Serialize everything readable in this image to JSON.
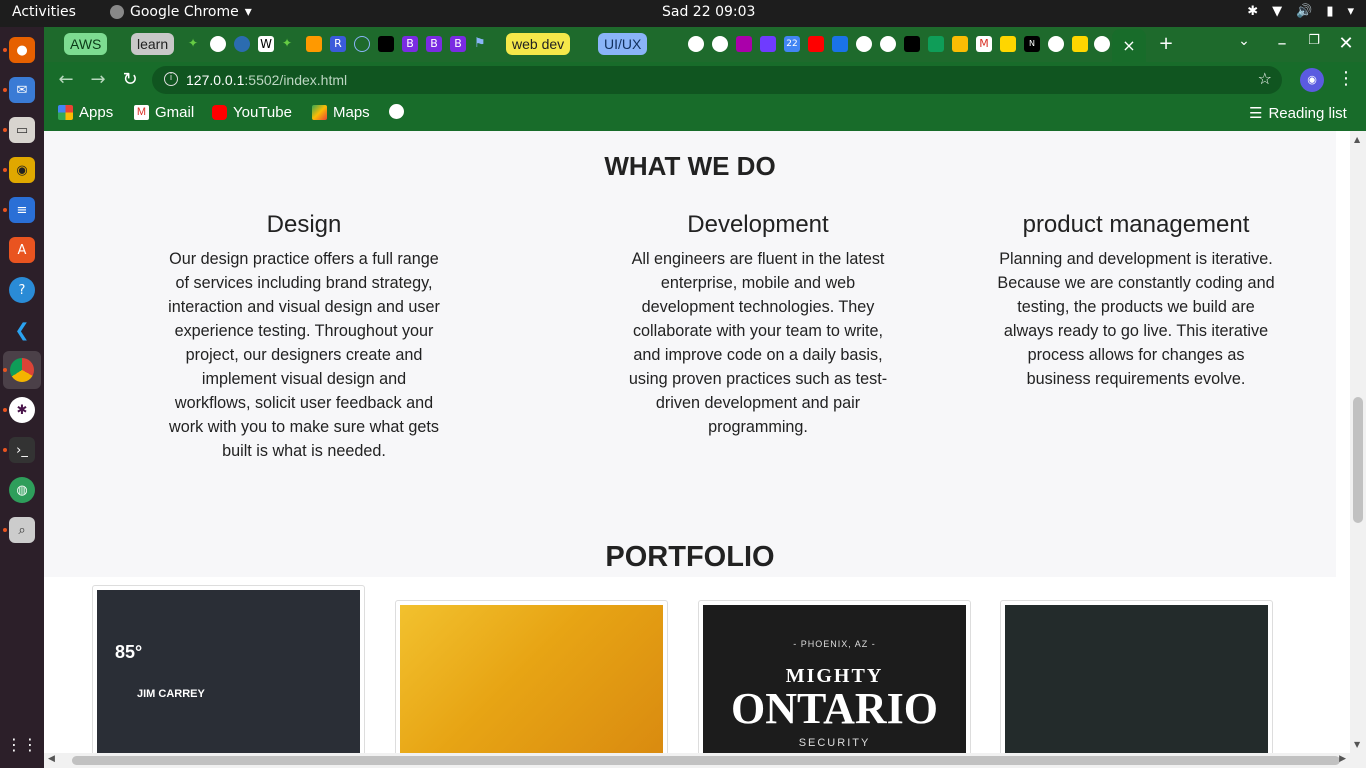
{
  "system_bar": {
    "activities": "Activities",
    "app_name": "Google Chrome",
    "clock": "Sad 22  09:03"
  },
  "tabs": {
    "groups": [
      {
        "label": "AWS",
        "color": "#7ddc91"
      },
      {
        "label": "learn",
        "color": "#c8c8c8"
      },
      {
        "label": "web dev",
        "color": "#f5e84a"
      },
      {
        "label": "UI/UX",
        "color": "#8ab4f8"
      }
    ],
    "active_tab_close": "×",
    "new_tab": "+"
  },
  "toolbar": {
    "url_host": "127.0.0.1",
    "url_path": ":5502/index.html"
  },
  "bookmarks": {
    "apps": "Apps",
    "gmail": "Gmail",
    "youtube": "YouTube",
    "maps": "Maps",
    "reading_list": "Reading list"
  },
  "page": {
    "what_we_do": "WHAT WE DO",
    "services": [
      {
        "title": "Design",
        "text": "Our design practice offers a full range of services including brand strategy, interaction and visual design and user experience testing. Throughout your project, our designers create and implement visual design and workflows, solicit user feedback and work with you to make sure what gets built is what is needed."
      },
      {
        "title": "Development",
        "text": "All engineers are fluent in the latest enterprise, mobile and web development technologies. They collaborate with your team to write, and improve code on a daily basis, using proven practices such as test-driven development and pair programming."
      },
      {
        "title": "product management",
        "text": "Planning and development is iterative. Because we are constantly coding and testing, the products we build are always ready to go live. This iterative process allows for changes as business requirements evolve."
      }
    ],
    "portfolio": "PORTFOLIO",
    "portfolio_items": [
      {
        "temp": "85°",
        "name": "JIM CARREY"
      },
      {},
      {
        "location": "- PHOENIX, AZ -",
        "line1": "MIGHTY",
        "line2": "ONTARIO",
        "line3": "SECURITY"
      },
      {}
    ]
  }
}
